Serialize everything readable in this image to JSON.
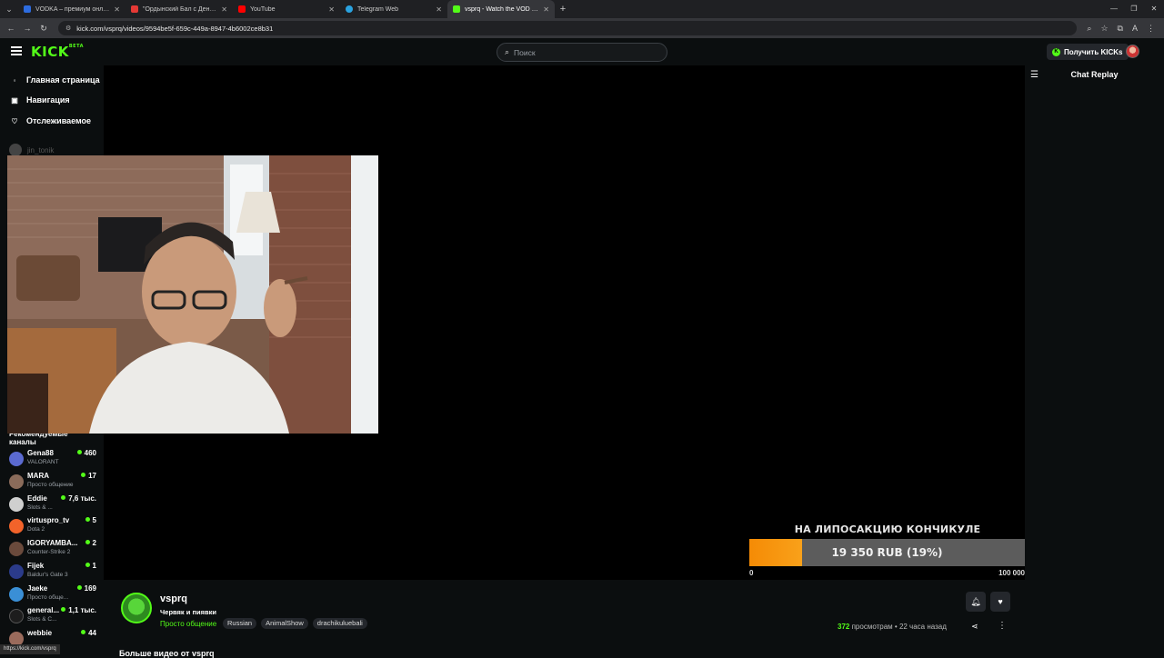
{
  "browser": {
    "tabs": [
      {
        "title": "VODKA – премиум онлайн-ка",
        "color": "#2d6cdf"
      },
      {
        "title": "\"Ордынский Бал с Денисом Д",
        "color": "#e53935"
      },
      {
        "title": "YouTube",
        "color": "#ff0000"
      },
      {
        "title": "Telegram Web",
        "color": "#2aa3e0"
      },
      {
        "title": "vsprq - Watch the VOD on Kick",
        "color": "#53fc18"
      }
    ],
    "url": "kick.com/vsprq/videos/9594be5f-659c-449a-8947-4b6002ce8b31",
    "status_url": "https://kick.com/vsprq"
  },
  "header": {
    "logo": "KICK",
    "logo_badge": "BETA",
    "search_placeholder": "Поиск",
    "get_kicks_label": "Получить KICKs",
    "accent": "#53fc18"
  },
  "sidebar": {
    "nav": [
      {
        "label": "Главная страница",
        "icon": "home-icon"
      },
      {
        "label": "Навигация",
        "icon": "compass-icon"
      },
      {
        "label": "Отслеживаемое",
        "icon": "heart-icon"
      }
    ],
    "followed_hint": "jin_tonik",
    "recommended_title": "Рекомендуемые каналы",
    "channels": [
      {
        "name": "Gena88",
        "category": "VALORANT",
        "viewers": "460",
        "color": "#5b6ad0"
      },
      {
        "name": "MARA",
        "category": "Просто общение",
        "viewers": "17",
        "color": "#8a6b5a"
      },
      {
        "name": "Eddie",
        "category": "Slots & ...",
        "viewers": "7,6 тыс.",
        "color": "#cfcfcf"
      },
      {
        "name": "virtuspro_tv",
        "category": "Dota 2",
        "viewers": "5",
        "color": "#f2632a"
      },
      {
        "name": "IGORYAMBA...",
        "category": "Counter-Strike 2",
        "viewers": "2",
        "color": "#6a4a3c"
      },
      {
        "name": "Fijek",
        "category": "Baldur's Gate 3",
        "viewers": "1",
        "color": "#2b3b8a"
      },
      {
        "name": "Jaeke",
        "category": "Просто обще...",
        "viewers": "169",
        "color": "#3a8fd6"
      },
      {
        "name": "general...",
        "category": "Slots & C...",
        "viewers": "1,1 тыс.",
        "color": "#1d1d1d"
      },
      {
        "name": "webbie",
        "category": "",
        "viewers": "44",
        "color": "#9a6b5c"
      }
    ]
  },
  "overlay": {
    "donation_title": "НА ЛИПОСАКЦИЮ КОНЧИКУЛЕ",
    "donation_amount": "19 350 RUB (19%)",
    "donation_progress": 0.19,
    "donation_min": "0",
    "donation_max": "100 000"
  },
  "stream": {
    "streamer": "vsprq",
    "title": "Червяк и пиявки",
    "category": "Просто общение",
    "tags": [
      "Russian",
      "AnimalShow",
      "drachikuluebali"
    ],
    "views_count": "372",
    "views_label": "просмотрам",
    "time_ago": "22 часа назад",
    "more_videos": "Больше видео от vsprq"
  },
  "chat": {
    "title": "Chat Replay"
  }
}
